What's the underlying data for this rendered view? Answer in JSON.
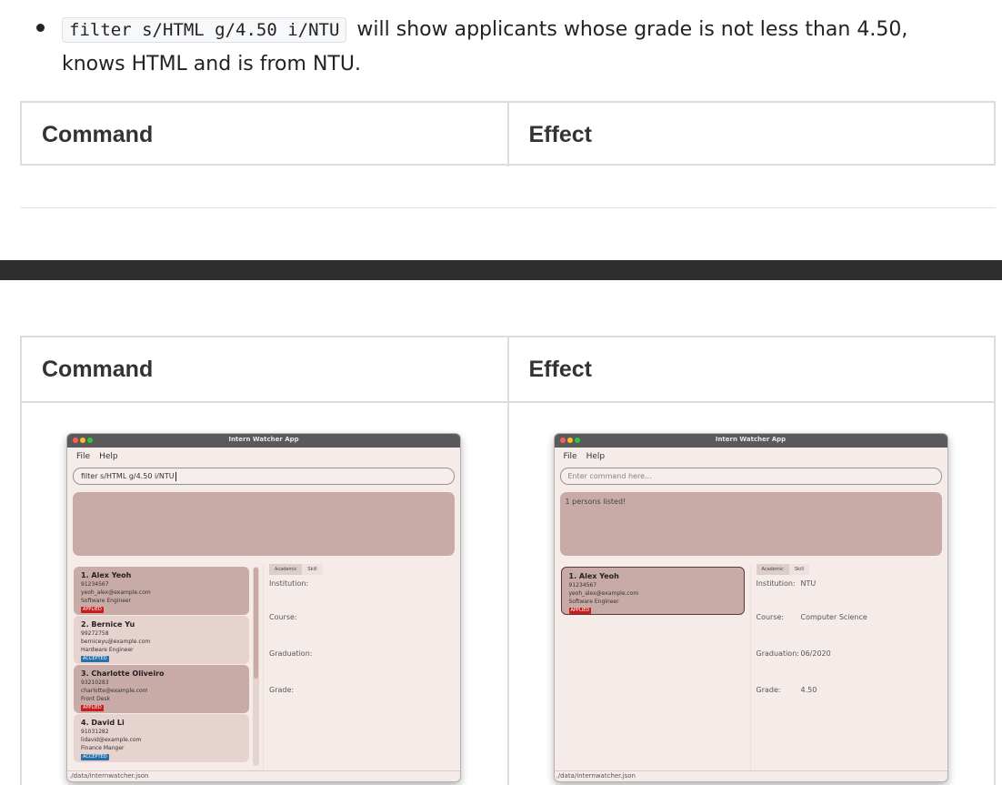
{
  "bullet": {
    "code": "filter s/HTML g/4.50 i/NTU",
    "text_line1": "will show applicants whose grade is not less than 4.50,",
    "text_line2": "knows HTML and is from NTU."
  },
  "table1": {
    "col1": "Command",
    "col2": "Effect"
  },
  "table2": {
    "col1": "Command",
    "col2": "Effect"
  },
  "app": {
    "window_title": "Intern Watcher App",
    "menu": [
      "File",
      "Help"
    ],
    "status_path": "./data/internwatcher.json",
    "tabs": [
      "Academic",
      "Skill"
    ],
    "detail_labels": [
      "Institution:",
      "Course:",
      "Graduation:",
      "Grade:"
    ]
  },
  "left_app": {
    "command_value": "filter s/HTML g/4.50 i/NTU",
    "result_text": "",
    "cards": [
      {
        "name": "1.  Alex Yeoh",
        "phone": "91234567",
        "email": "yeoh_alex@example.com",
        "role": "Software Engineer",
        "status": "APPLIED",
        "status_type": "applied"
      },
      {
        "name": "2.  Bernice Yu",
        "phone": "99272758",
        "email": "berniceyu@example.com",
        "role": "Hardware Engineer",
        "status": "ACCEPTED",
        "status_type": "accepted"
      },
      {
        "name": "3.  Charlotte Oliveiro",
        "phone": "93210283",
        "email": "charlotte@example.com",
        "role": "Front Desk",
        "status": "APPLIED",
        "status_type": "applied"
      },
      {
        "name": "4.  David Li",
        "phone": "91031282",
        "email": "lidavid@example.com",
        "role": "Finance Manger",
        "status": "ACCEPTED",
        "status_type": "accepted"
      }
    ]
  },
  "right_app": {
    "command_placeholder": "Enter command here...",
    "result_text": "1 persons listed!",
    "cards": [
      {
        "name": "1.  Alex Yeoh",
        "phone": "91234567",
        "email": "yeoh_alex@example.com",
        "role": "Software Engineer",
        "status": "APPLIED",
        "status_type": "applied"
      }
    ],
    "detail_values": [
      "NTU",
      "Computer Science",
      "06/2020",
      "4.50"
    ]
  }
}
